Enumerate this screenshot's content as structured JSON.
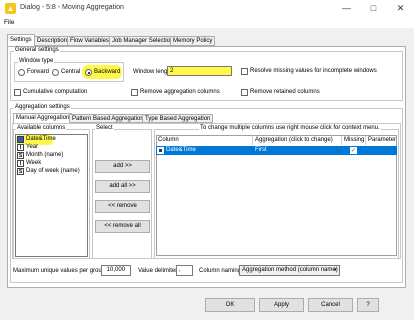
{
  "window": {
    "title": "Dialog - 5:8 - Moving Aggregation",
    "minimize": "—",
    "maximize": "□",
    "close": "✕"
  },
  "menu": {
    "file": "File"
  },
  "tabs": [
    "Settings",
    "Description",
    "Flow Variables",
    "Job Manager Selection",
    "Memory Policy"
  ],
  "general": {
    "label": "General settings",
    "window_type_label": "Window type",
    "forward": "Forward",
    "central": "Central",
    "backward": "Backward",
    "window_length_label": "Window length",
    "window_length_value": "2",
    "resolve_missing": "Resolve missing values for incomplete windows",
    "cumulative": "Cumulative computation",
    "remove_aggregation": "Remove aggregation columns",
    "remove_retained": "Remove retained columns"
  },
  "aggregation": {
    "label": "Aggregation settings",
    "subtabs": [
      "Manual Aggregation",
      "Pattern Based Aggregation",
      "Type Based Aggregation"
    ],
    "available_label": "Available columns",
    "available_columns": [
      {
        "type": "calendar-icon",
        "name": "Date&Time"
      },
      {
        "type": "I",
        "name": "Year"
      },
      {
        "type": "S",
        "name": "Month (name)"
      },
      {
        "type": "I",
        "name": "Week"
      },
      {
        "type": "S",
        "name": "Day of week (name)"
      }
    ],
    "select_label": "Select",
    "add": "add >>",
    "add_all": "add all >>",
    "remove": "<< remove",
    "remove_all": "<< remove all",
    "hint": "To change multiple columns use right mouse click for context menu.",
    "headers": [
      "Column",
      "Aggregation (click to change)",
      "Missing",
      "Parameter"
    ],
    "rows": [
      {
        "column": "Date&Time",
        "aggregation": "First",
        "missing": "✓",
        "parameter": ""
      }
    ],
    "max_unique_label": "Maximum unique values per group",
    "max_unique_value": "10,000",
    "delimiter_label": "Value delimiter",
    "delimiter_value": ",",
    "naming_label": "Column naming",
    "naming_value": "Aggregation method (column name)"
  },
  "buttons": {
    "ok": "OK",
    "apply": "Apply",
    "cancel": "Cancel",
    "help": "?"
  },
  "colors": {
    "highlight": "#fff84a",
    "selection": "#0078d7"
  }
}
